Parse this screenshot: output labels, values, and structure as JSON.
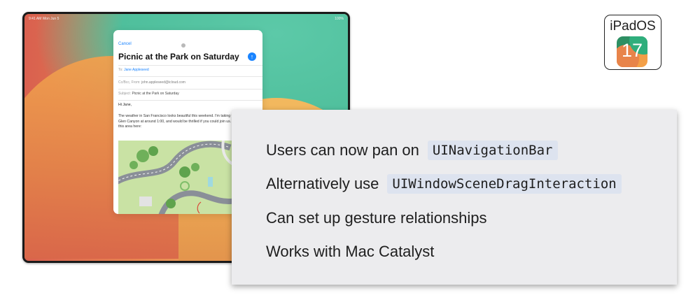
{
  "ipad": {
    "status_time": "9:41 AM",
    "status_date": "Mon Jun 5",
    "status_right": "100%",
    "mail": {
      "cancel_label": "Cancel",
      "title": "Picnic at the Park on Saturday",
      "to_label": "To:",
      "to_value": "Jane Appleseed",
      "cc_label": "Cc/Bcc, From:",
      "cc_value": "john.appleseed@icloud.com",
      "subject_label": "Subject:",
      "subject_value": "Picnic at the Park on Saturday",
      "greeting": "Hi Jane,",
      "body": "The weather in San Francisco looks beautiful this weekend. I'm taking the kids over to Glen Canyon at around 1:00, and would be thrilled if you could join us. We'll be around this area here:"
    }
  },
  "badge": {
    "label": "iPadOS",
    "number": "17"
  },
  "card": {
    "bullets": [
      {
        "text": "Users can now pan on",
        "code": "UINavigationBar"
      },
      {
        "text": "Alternatively use",
        "code": "UIWindowSceneDragInteraction"
      },
      {
        "text": "Can set up gesture relationships",
        "code": ""
      },
      {
        "text": "Works with Mac Catalyst",
        "code": ""
      }
    ]
  },
  "colors": {
    "accent": "#1a84ff",
    "card_background": "#ececee",
    "code_background": "#dde3ef"
  }
}
